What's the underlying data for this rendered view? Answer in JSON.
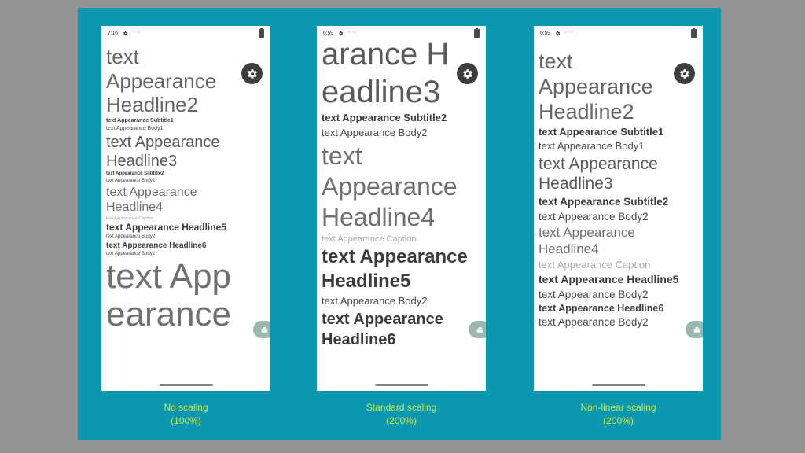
{
  "slide": {
    "background_outer": "#949494",
    "panel_color": "#0b97ad",
    "caption_color": "#cbe84b"
  },
  "phones": [
    {
      "id": "no-scaling",
      "status_bar": {
        "time": "7:16",
        "gear_icon": "gear-icon",
        "dots_icon": "more-icon",
        "battery_icon": "battery-icon"
      },
      "fab": {
        "icon": "gear-icon",
        "label": "Settings"
      },
      "chip": {
        "icon": "android-icon"
      },
      "lines": [
        {
          "style": "h2",
          "text": "text"
        },
        {
          "style": "h2",
          "text": "Appearance"
        },
        {
          "style": "h2",
          "text": "Headline2"
        },
        {
          "style": "sub1",
          "text": "text Appearance Subtitle1"
        },
        {
          "style": "body1",
          "text": "text Appearance Body1"
        },
        {
          "style": "h3",
          "text": "text Appearance"
        },
        {
          "style": "h3",
          "text": "Headline3"
        },
        {
          "style": "sub2",
          "text": "text Appearance Subtitle2"
        },
        {
          "style": "body2",
          "text": "text Appearance Body2"
        },
        {
          "style": "h4",
          "text": "text Appearance"
        },
        {
          "style": "h4",
          "text": "Headline4"
        },
        {
          "style": "cap",
          "text": "text Appearance Caption"
        },
        {
          "style": "h5",
          "text": "text Appearance Headline5"
        },
        {
          "style": "body2",
          "text": "text Appearance Body2"
        },
        {
          "style": "h6",
          "text": "text Appearance Headline6"
        },
        {
          "style": "body2",
          "text": "text Appearance Body2"
        },
        {
          "style": "big",
          "text": "text App"
        },
        {
          "style": "big",
          "text": "earance"
        }
      ],
      "caption": {
        "title": "No scaling",
        "percent": "(100%)"
      }
    },
    {
      "id": "standard-scaling",
      "status_bar": {
        "time": "6:59",
        "gear_icon": "gear-icon",
        "dots_icon": "more-icon",
        "battery_icon": "battery-icon"
      },
      "fab": {
        "icon": "gear-icon",
        "label": "Settings"
      },
      "chip": {
        "icon": "android-icon"
      },
      "lines": [
        {
          "style": "h3",
          "text": "arance H"
        },
        {
          "style": "h3",
          "text": "eadline3"
        },
        {
          "style": "sub2",
          "text": "text Appearance Subtitle2"
        },
        {
          "style": "body2",
          "text": "text Appearance Body2"
        },
        {
          "style": "h4",
          "text": "text"
        },
        {
          "style": "h4",
          "text": "Appearance"
        },
        {
          "style": "h4",
          "text": "Headline4"
        },
        {
          "style": "cap",
          "text": "text Appearance Caption"
        },
        {
          "style": "h5",
          "text": "text Appearance"
        },
        {
          "style": "h5",
          "text": "Headline5"
        },
        {
          "style": "body2",
          "text": "text Appearance Body2"
        },
        {
          "style": "h6",
          "text": "text Appearance"
        },
        {
          "style": "h6",
          "text": "Headline6"
        }
      ],
      "caption": {
        "title": "Standard scaling",
        "percent": "(200%)"
      }
    },
    {
      "id": "non-linear-scaling",
      "status_bar": {
        "time": "6:59",
        "gear_icon": "gear-icon",
        "dots_icon": "more-icon",
        "battery_icon": "battery-icon"
      },
      "fab": {
        "icon": "gear-icon",
        "label": "Settings"
      },
      "chip": {
        "icon": "android-icon"
      },
      "lines": [
        {
          "style": "h2",
          "text": "text"
        },
        {
          "style": "h2",
          "text": "Appearance"
        },
        {
          "style": "h2",
          "text": "Headline2"
        },
        {
          "style": "sub1",
          "text": "text Appearance Subtitle1"
        },
        {
          "style": "body1",
          "text": "text Appearance Body1"
        },
        {
          "style": "h3",
          "text": "text Appearance"
        },
        {
          "style": "h3",
          "text": "Headline3"
        },
        {
          "style": "sub2",
          "text": "text Appearance Subtitle2"
        },
        {
          "style": "body2",
          "text": "text Appearance Body2"
        },
        {
          "style": "h4",
          "text": "text Appearance"
        },
        {
          "style": "h4",
          "text": "Headline4"
        },
        {
          "style": "cap",
          "text": "text Appearance Caption"
        },
        {
          "style": "h5",
          "text": "text Appearance Headline5"
        },
        {
          "style": "body2",
          "text": "text Appearance Body2"
        },
        {
          "style": "h6",
          "text": "text Appearance Headline6"
        },
        {
          "style": "body2",
          "text": "text Appearance Body2"
        }
      ],
      "caption": {
        "title": "Non-linear scaling",
        "percent": "(200%)"
      }
    }
  ]
}
